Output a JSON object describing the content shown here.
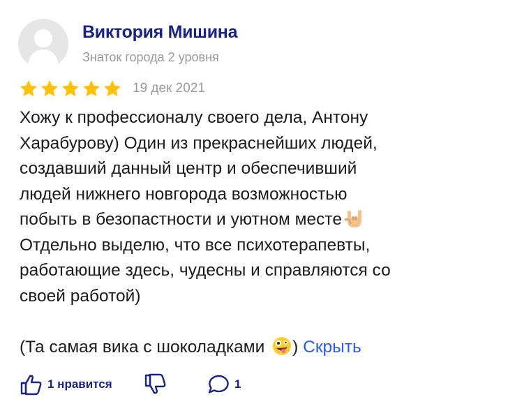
{
  "author": {
    "name": "Виктория Мишина",
    "level": "Знаток города 2 уровня"
  },
  "review": {
    "rating": 5,
    "max_rating": 5,
    "date": "19 дек 2021",
    "lines": [
      "Хожу к профессионалу своего дела, Антону",
      "Харабурову) Один из прекраснейших людей,",
      "создавший данный центр и обеспечивший",
      "людей нижнего новгорода возможностью",
      "побыть в безопастности и уютном месте",
      "Отдельно выделю, что все психотерапевты,",
      "работающие здесь, чудесны и справляются со",
      "своей работой)"
    ],
    "last_line_before": "(Та самая вика с шоколадками",
    "last_line_after": ")",
    "collapse_label": "Скрыть",
    "emoji_1": "rock-hand-emoji",
    "emoji_2": "zany-face-emoji"
  },
  "actions": {
    "like_label": "1 нравится",
    "comments_count": "1"
  },
  "colors": {
    "name": "#1a237e",
    "muted": "#9a9a9a",
    "star": "#ffc107",
    "link": "#2e5bd6",
    "text": "#1b1b1b"
  },
  "icons": {
    "avatar": "person-silhouette",
    "like": "thumbs-up-icon",
    "dislike": "thumbs-down-icon",
    "comment": "comment-bubble-icon"
  }
}
